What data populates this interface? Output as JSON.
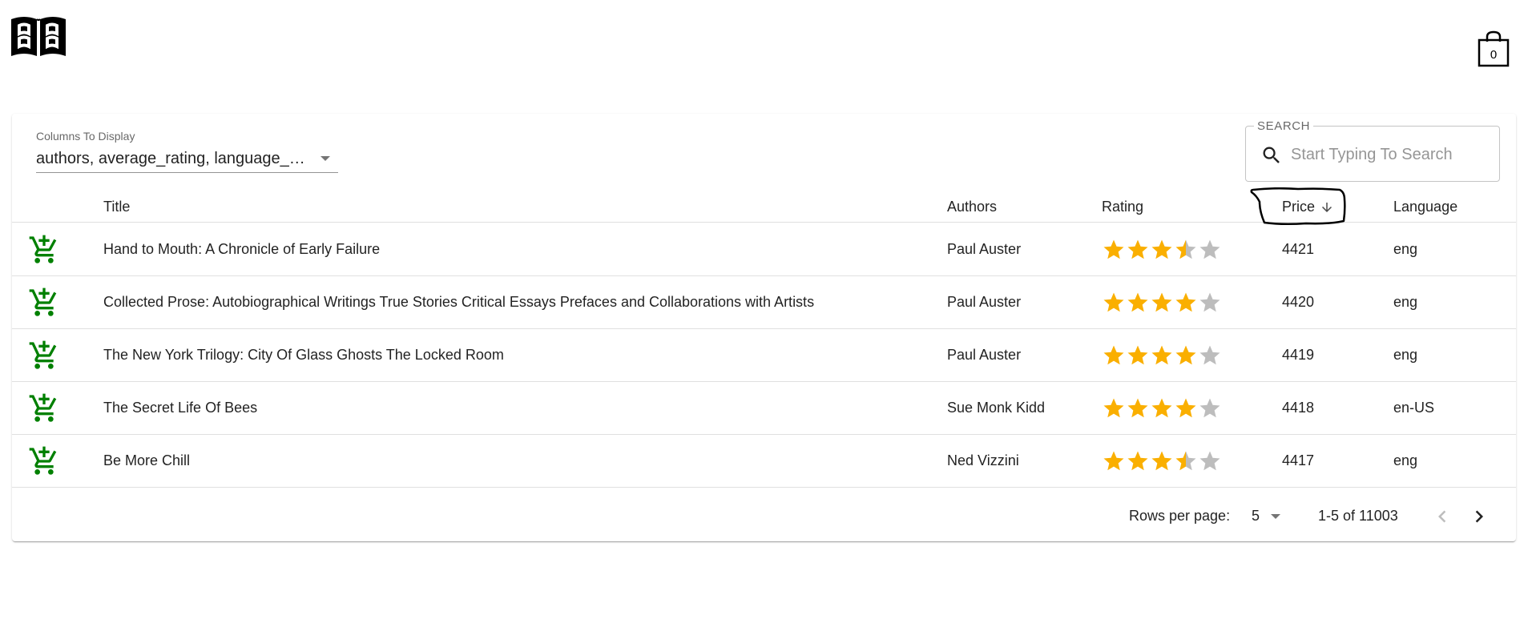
{
  "header": {
    "logo_icon": "open-book-icon",
    "cart_icon": "shopping-bag-icon",
    "cart_count": "0"
  },
  "columns_select": {
    "label": "Columns To Display",
    "value": "authors, average_rating, language_code, price"
  },
  "search": {
    "legend": "SEARCH",
    "placeholder": "Start Typing To Search",
    "icon": "search-icon"
  },
  "table": {
    "headers": {
      "title": "Title",
      "authors": "Authors",
      "rating": "Rating",
      "price": "Price",
      "language": "Language"
    },
    "sort": {
      "column": "price",
      "direction": "descending",
      "icon": "arrow-down-icon"
    },
    "rows": [
      {
        "title": "Hand to Mouth: A Chronicle of Early Failure",
        "authors": "Paul Auster",
        "rating": 3.5,
        "price": "4421",
        "language": "eng"
      },
      {
        "title": "Collected Prose: Autobiographical Writings True Stories Critical Essays Prefaces and Collaborations with Artists",
        "authors": "Paul Auster",
        "rating": 4,
        "price": "4420",
        "language": "eng"
      },
      {
        "title": "The New York Trilogy: City Of Glass Ghosts The Locked Room",
        "authors": "Paul Auster",
        "rating": 4,
        "price": "4419",
        "language": "eng"
      },
      {
        "title": "The Secret Life Of Bees",
        "authors": "Sue Monk Kidd",
        "rating": 4,
        "price": "4418",
        "language": "en-US"
      },
      {
        "title": "Be More Chill",
        "authors": "Ned Vizzini",
        "rating": 3.5,
        "price": "4417",
        "language": "eng"
      }
    ],
    "row_icon": "add-shopping-cart-icon",
    "max_rating": 5
  },
  "pagination": {
    "rows_per_page_label": "Rows per page:",
    "rows_per_page": "5",
    "range": "1-5 of 11003",
    "prev_icon": "chevron-left-icon",
    "next_icon": "chevron-right-icon"
  },
  "colors": {
    "star_filled": "#faaf00",
    "star_empty": "#bdbdbd",
    "cart_add": "#008000",
    "annotation": "#000000"
  }
}
